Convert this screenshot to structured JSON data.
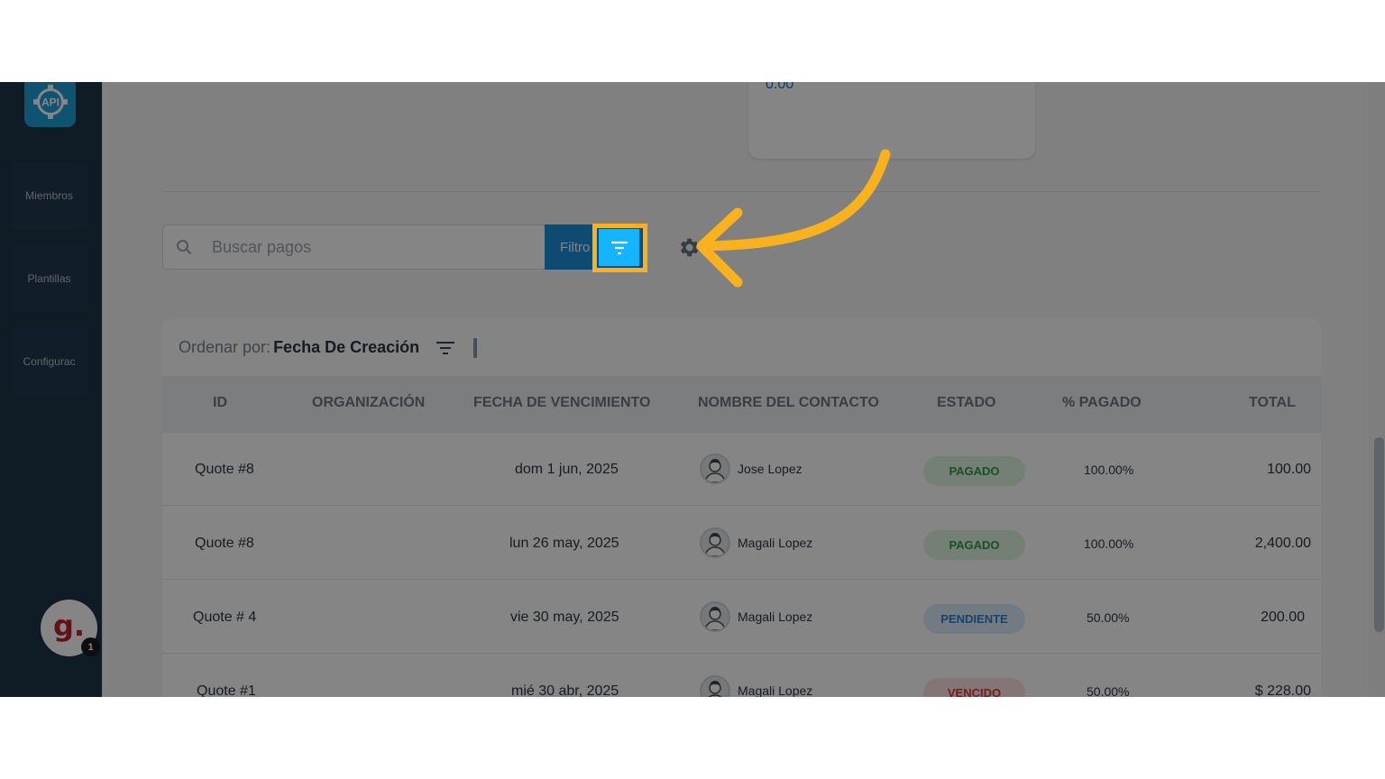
{
  "sidebar": {
    "logo_text": "API",
    "items": [
      {
        "label": "Miembros"
      },
      {
        "label": "Plantillas"
      },
      {
        "label": "Configurac"
      }
    ],
    "user_avatar_letter": "g.",
    "notification_count": "1"
  },
  "stat_card": {
    "value": "0.00"
  },
  "search": {
    "placeholder": "Buscar pagos"
  },
  "filter": {
    "button_label": "Filtro"
  },
  "sort": {
    "label": "Ordenar por:",
    "value": "Fecha De Creación"
  },
  "table": {
    "columns": [
      "ID",
      "ORGANIZACIÓN",
      "FECHA DE VENCIMIENTO",
      "NOMBRE DEL CONTACTO",
      "ESTADO",
      "% PAGADO",
      "TOTAL"
    ],
    "rows": [
      {
        "id": "Quote #8",
        "organization": "",
        "due_date": "dom 1 jun, 2025",
        "contact": "Jose Lopez",
        "status": "PAGADO",
        "paid_pct": "100.00%",
        "total": "100.00"
      },
      {
        "id": "Quote #8",
        "organization": "",
        "due_date": "lun 26 may, 2025",
        "contact": "Magali Lopez",
        "status": "PAGADO",
        "paid_pct": "100.00%",
        "total": "2,400.00"
      },
      {
        "id": "Quote # 4",
        "organization": "",
        "due_date": "vie 30 may, 2025",
        "contact": "Magali Lopez",
        "status": "PENDIENTE",
        "paid_pct": "50.00%",
        "total": "200.00"
      },
      {
        "id": "Quote #1",
        "organization": "",
        "due_date": "mié 30 abr, 2025",
        "contact": "Magali Lopez",
        "status": "VENCIDO",
        "paid_pct": "50.00%",
        "total": "$ 228.00"
      }
    ]
  },
  "colors": {
    "sidebar": "#1e3448",
    "primary": "#1b8ed8",
    "highlight": "#f9b21d",
    "status_paid": "#2e9b46",
    "status_pending": "#2a80d2",
    "status_overdue": "#d63b3b"
  }
}
